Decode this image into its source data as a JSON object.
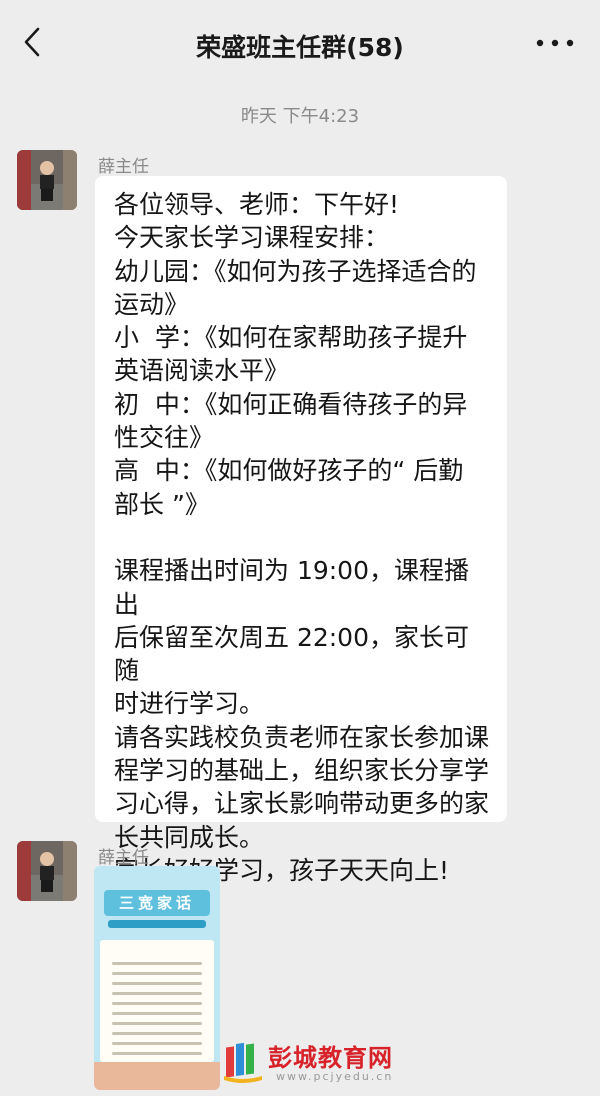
{
  "header": {
    "title": "荣盛班主任群(58)",
    "back_icon": "chevron-left-icon",
    "more_icon": "more-dots-icon"
  },
  "timestamp": "昨天 下午4:23",
  "messages": [
    {
      "sender": "薛主任",
      "lines": [
        "各位领导、老师：下午好!",
        "今天家长学习课程安排：",
        "幼儿园：《如何为孩子选择适合的",
        "运动》",
        "小  学：《如何在家帮助孩子提升",
        "英语阅读水平》",
        "初  中：《如何正确看待孩子的异",
        "性交往》",
        "高  中：《如何做好孩子的“ 后勤",
        "部长 ”》",
        "",
        "课程播出时间为 19:00，课程播出",
        "后保留至次周五 22:00，家长可随",
        "时进行学习。",
        "请各实践校负责老师在家长参加课",
        "程学习的基础上，组织家长分享学",
        "习心得，让家长影响带动更多的家",
        "长共同成长。",
        "家长好好学习，孩子天天向上!"
      ]
    },
    {
      "sender": "薛主任",
      "image": {
        "title": "三宽家话"
      }
    }
  ],
  "watermark": {
    "text": "彭城教育网",
    "url": "www.pcjyedu.cn"
  }
}
